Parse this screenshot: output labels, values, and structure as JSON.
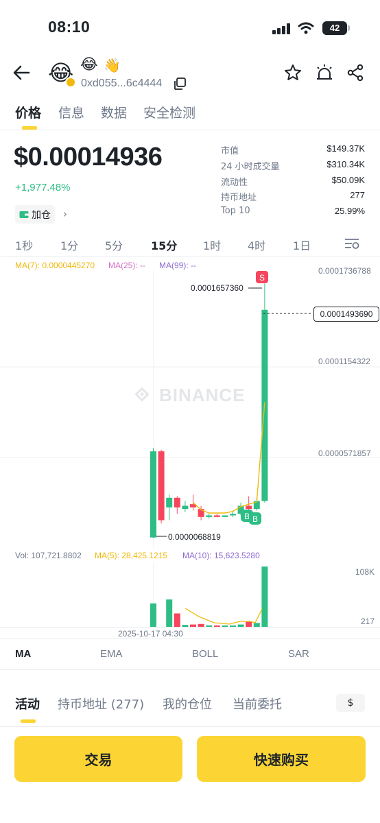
{
  "status_bar": {
    "time": "08:10",
    "battery": "42"
  },
  "header": {
    "token_address": "0xd055...6c4444",
    "emoji_1": "😂",
    "emoji_2": "😂",
    "emoji_3": "👋"
  },
  "tabs": [
    {
      "label": "价格",
      "active": true
    },
    {
      "label": "信息",
      "active": false
    },
    {
      "label": "数据",
      "active": false
    },
    {
      "label": "安全检测",
      "active": false
    }
  ],
  "price": {
    "value": "$0.00014936",
    "change": "+1,977.48%",
    "add_position": "加仓"
  },
  "stats": [
    {
      "label": "市值",
      "value": "$149.37K"
    },
    {
      "label": "24 小时成交量",
      "value": "$310.34K"
    },
    {
      "label": "流动性",
      "value": "$50.09K"
    },
    {
      "label": "持币地址",
      "value": "277"
    },
    {
      "label": "Top 10",
      "value": "25.99%"
    }
  ],
  "intervals": [
    {
      "label": "1秒",
      "active": false
    },
    {
      "label": "1分",
      "active": false
    },
    {
      "label": "5分",
      "active": false
    },
    {
      "label": "15分",
      "active": true
    },
    {
      "label": "1时",
      "active": false
    },
    {
      "label": "4时",
      "active": false
    },
    {
      "label": "1日",
      "active": false
    }
  ],
  "ma_legend": {
    "ma7": "MA(7): 0.0000445270",
    "ma25": "MA(25): --",
    "ma99": "MA(99): --"
  },
  "chart": {
    "price_axis": [
      "0.0001736788",
      "0.0001154322",
      "0.0000571857"
    ],
    "high_label": "0.0001657360",
    "low_label": "0.0000068819",
    "current_price": "0.0001493690",
    "watermark": "BINANCE",
    "sell_marker": "S",
    "buy_marker": "B",
    "time_label": "2025-10-17 04:30"
  },
  "volume": {
    "vol": "Vol: 107,721.8802",
    "ma5": "MA(5): 28,425.1215",
    "ma10": "MA(10): 15,623.5280",
    "axis_top": "108K",
    "axis_bottom": "217"
  },
  "indicators": [
    {
      "label": "MA",
      "active": true
    },
    {
      "label": "EMA",
      "active": false
    },
    {
      "label": "BOLL",
      "active": false
    },
    {
      "label": "SAR",
      "active": false
    }
  ],
  "bottom_tabs": [
    {
      "label": "活动",
      "active": true
    },
    {
      "label": "持币地址 (277)",
      "active": false
    },
    {
      "label": "我的仓位",
      "active": false
    },
    {
      "label": "当前委托",
      "active": false
    }
  ],
  "currency": "$",
  "actions": {
    "trade": "交易",
    "quick_buy": "快速购买"
  },
  "colors": {
    "up": "#2ebd85",
    "down": "#f6465d",
    "accent": "#fcd535",
    "ma7": "#f0b90b",
    "ma25": "#d670c8",
    "ma99": "#8e6bd1"
  },
  "chart_data": {
    "type": "candlestick",
    "interval": "15分",
    "candles": [
      {
        "open": 7.2e-06,
        "high": 6.3e-05,
        "low": 6.8819e-06,
        "close": 6.1e-05
      },
      {
        "open": 6.1e-05,
        "high": 6.2e-05,
        "low": 1.6e-05,
        "close": 1.8e-05
      },
      {
        "open": 2.6e-05,
        "high": 3.4e-05,
        "low": 1.8e-05,
        "close": 3.2e-05
      },
      {
        "open": 3.2e-05,
        "high": 3.3e-05,
        "low": 2.2e-05,
        "close": 2.6e-05
      },
      {
        "open": 2.5e-05,
        "high": 3e-05,
        "low": 2.3e-05,
        "close": 2.7e-05
      },
      {
        "open": 2.8e-05,
        "high": 3.4e-05,
        "low": 2.4e-05,
        "close": 2.6e-05
      },
      {
        "open": 2.5e-05,
        "high": 2.7e-05,
        "low": 1.8e-05,
        "close": 2e-05
      },
      {
        "open": 2e-05,
        "high": 2.2e-05,
        "low": 1.9e-05,
        "close": 2.1e-05
      },
      {
        "open": 2.1e-05,
        "high": 2.2e-05,
        "low": 2e-05,
        "close": 2e-05
      },
      {
        "open": 2e-05,
        "high": 2.1e-05,
        "low": 2e-05,
        "close": 2.1e-05
      },
      {
        "open": 2.1e-05,
        "high": 2.4e-05,
        "low": 2e-05,
        "close": 2.2e-05
      },
      {
        "open": 2.2e-05,
        "high": 2.9e-05,
        "low": 2.1e-05,
        "close": 2.7e-05
      },
      {
        "open": 2.7e-05,
        "high": 3.3e-05,
        "low": 2.2e-05,
        "close": 2.5e-05
      },
      {
        "open": 2.5e-05,
        "high": 3.2e-05,
        "low": 2.4e-05,
        "close": 3e-05
      },
      {
        "open": 3e-05,
        "high": 0.000165736,
        "low": 2.9e-05,
        "close": 0.000149369
      }
    ],
    "volumes": [
      42000,
      0,
      49000,
      24000,
      3500,
      4200,
      5200,
      2600,
      1400,
      1200,
      1900,
      4200,
      9000,
      7000,
      108000
    ],
    "y_axis_ticks": [
      0.0001736788,
      0.0001154322,
      5.71857e-05
    ],
    "volume_axis": [
      "108K",
      "217"
    ]
  }
}
